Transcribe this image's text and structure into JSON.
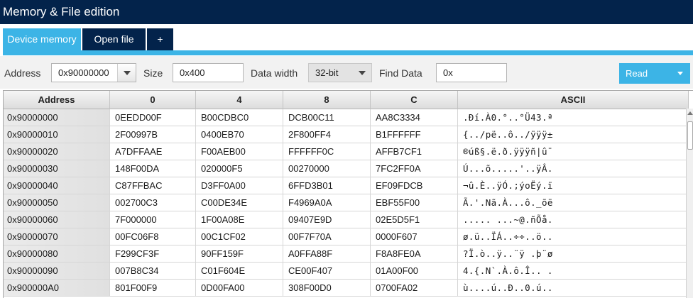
{
  "window": {
    "title": "Memory & File edition"
  },
  "tabs": [
    {
      "label": "Device memory"
    },
    {
      "label": "Open file"
    },
    {
      "label": "+"
    }
  ],
  "toolbar": {
    "address_label": "Address",
    "address_value": "0x90000000",
    "size_label": "Size",
    "size_value": "0x400",
    "data_width_label": "Data width",
    "data_width_value": "32-bit",
    "find_label": "Find Data",
    "find_value": "0x",
    "read_label": "Read"
  },
  "table": {
    "columns": [
      "Address",
      "0",
      "4",
      "8",
      "C",
      "ASCII"
    ],
    "rows": [
      {
        "address": "0x90000000",
        "c0": "0EEDD00F",
        "c4": "B00CDBC0",
        "c8": "DCB00C11",
        "cC": "AA8C3334",
        "ascii": ".Ðí.À0.°..°Ü43.ª"
      },
      {
        "address": "0x90000010",
        "c0": "2F00997B",
        "c4": "0400EB70",
        "c8": "2F800FF4",
        "cC": "B1FFFFFF",
        "ascii": "{../pë..ô../ÿÿÿ±"
      },
      {
        "address": "0x90000020",
        "c0": "A7DFFAAE",
        "c4": "F00AEB00",
        "c8": "FFFFFF0C",
        "cC": "AFFB7CF1",
        "ascii": "®úß§.ë.ð.ÿÿÿñ|û¯"
      },
      {
        "address": "0x90000030",
        "c0": "148F00DA",
        "c4": "020000F5",
        "c8": "00270000",
        "cC": "7FC2FF0A",
        "ascii": "Ú...õ.....'..ÿÂ."
      },
      {
        "address": "0x90000040",
        "c0": "C87FFBAC",
        "c4": "D3FF0A00",
        "c8": "6FFD3B01",
        "cC": "EF09FDCB",
        "ascii": "¬û.È..ÿÓ.;ýoËý.ï"
      },
      {
        "address": "0x90000050",
        "c0": "002700C3",
        "c4": "C00DE34E",
        "c8": "F4969A0A",
        "cC": "EBF55F00",
        "ascii": "Ã.'.Nã.À...ô._õë"
      },
      {
        "address": "0x90000060",
        "c0": "7F000000",
        "c4": "1F00A08E",
        "c8": "09407E9D",
        "cC": "02E5D5F1",
        "ascii": "..... ...~@.ñÕå."
      },
      {
        "address": "0x90000070",
        "c0": "00FC06F8",
        "c4": "00C1CF02",
        "c8": "00F7F70A",
        "cC": "0000F607",
        "ascii": "ø.ü..ÏÁ..÷÷..ö.."
      },
      {
        "address": "0x90000080",
        "c0": "F299CF3F",
        "c4": "90FF159F",
        "c8": "A0FFA88F",
        "cC": "F8A8FE0A",
        "ascii": "?Ï.ò..ÿ..¨ÿ .þ¨ø"
      },
      {
        "address": "0x90000090",
        "c0": "007B8C34",
        "c4": "C01F604E",
        "c8": "CE00F407",
        "cC": "01A00F00",
        "ascii": "4.{.N`.À.ô.Î.. ."
      },
      {
        "address": "0x900000A0",
        "c0": "801F00F9",
        "c4": "0D00FA00",
        "c8": "308F00D0",
        "cC": "0700FA02",
        "ascii": "ù....ú..Ð..0.ú.."
      }
    ]
  },
  "colors": {
    "titlebar": "#03234b",
    "accent": "#3cb4e6",
    "toolbar_bg": "#f2f2f2"
  },
  "icons": {
    "address_dropdown": "chevron-down-icon",
    "data_width_dropdown": "chevron-down-icon",
    "read_dropdown": "caret-down-icon",
    "scroll_up": "arrow-up-icon"
  }
}
